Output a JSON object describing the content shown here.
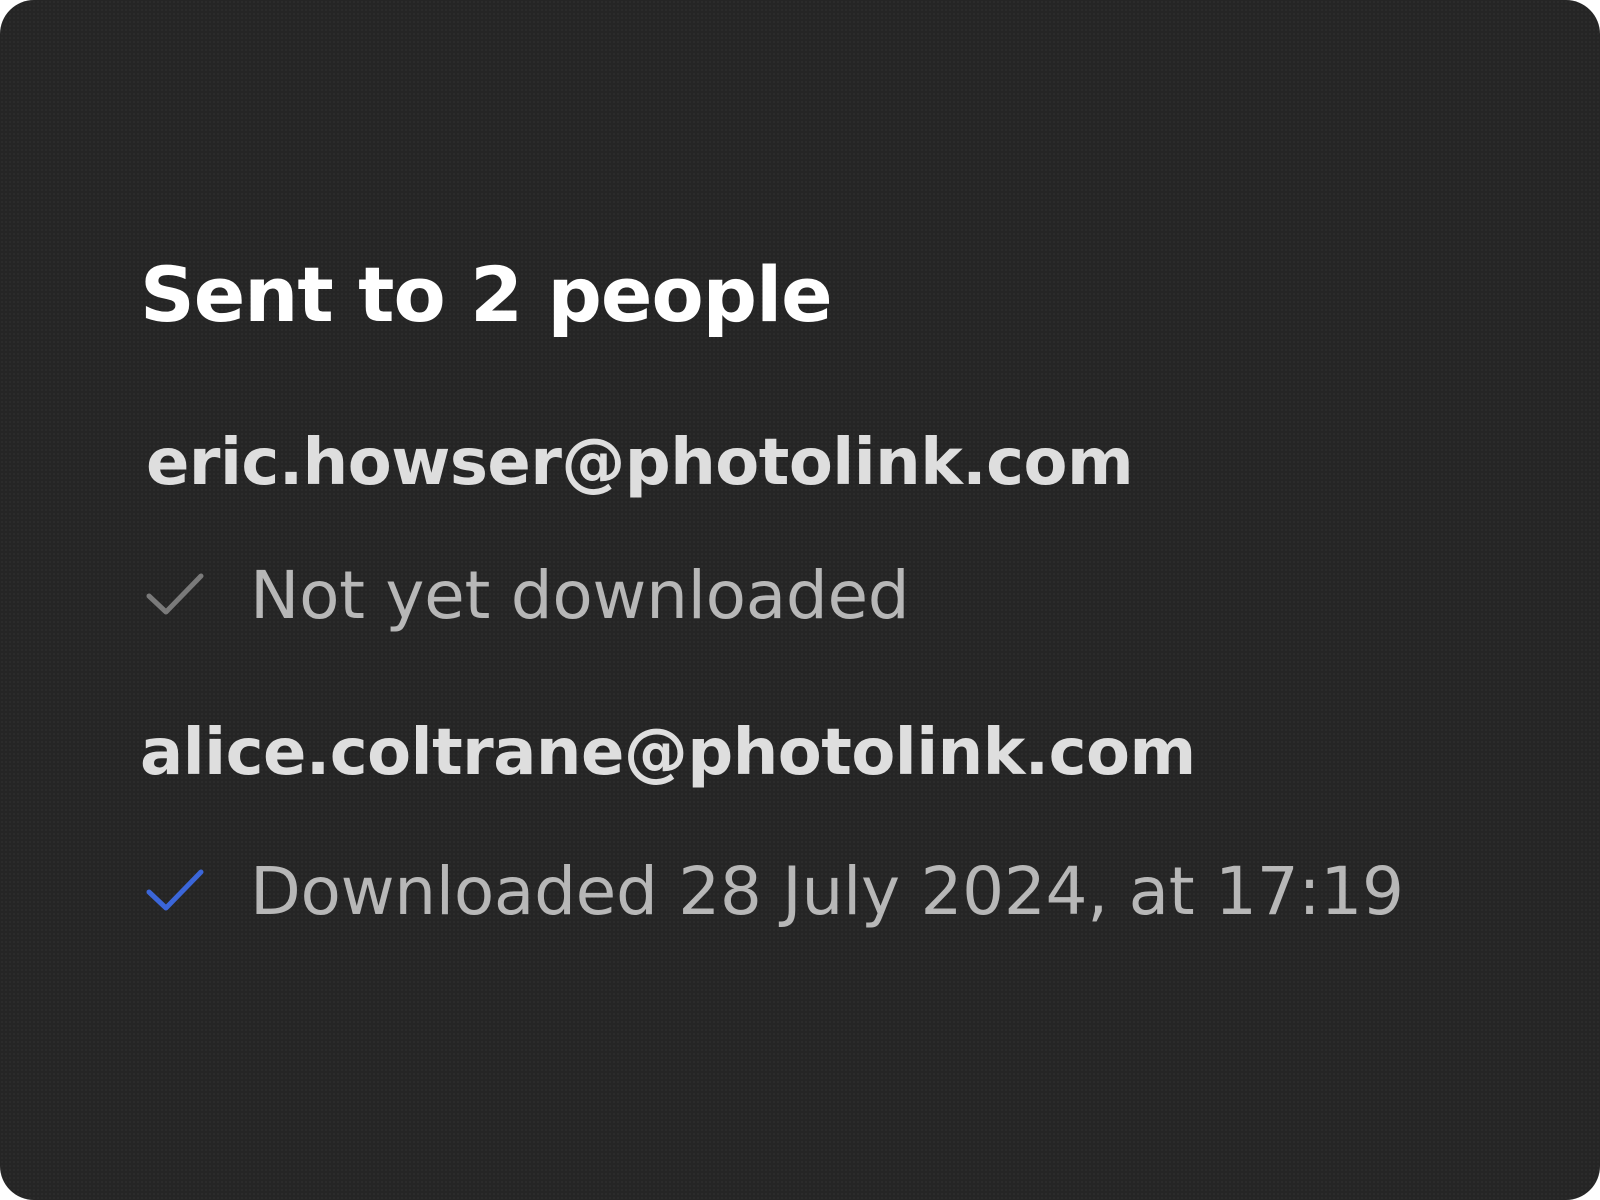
{
  "header": {
    "title": "Sent to 2 people"
  },
  "recipients": [
    {
      "email": "eric.howser@photolink.com",
      "status": "Not yet downloaded",
      "check_icon": "check-icon",
      "check_color": "#7a7a7a"
    },
    {
      "email": "alice.coltrane@photolink.com",
      "status": "Downloaded 28 July 2024, at 17:19",
      "check_icon": "check-icon",
      "check_color": "#3b66d9"
    }
  ],
  "colors": {
    "card_background": "#252525",
    "title": "#ffffff",
    "email": "#dedede",
    "status_text": "#b7b7b7"
  }
}
